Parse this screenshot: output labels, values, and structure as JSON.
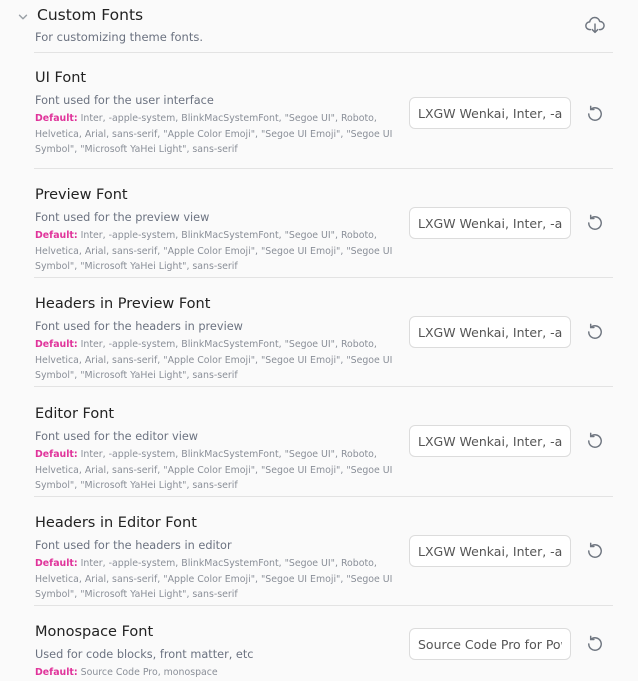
{
  "section": {
    "title": "Custom Fonts",
    "description": "For customizing theme fonts.",
    "collapse_icon": "chevron-down-icon",
    "export_icon": "cloud-download-icon"
  },
  "colors": {
    "default_label": "#e0339a",
    "description_text": "#6b7280"
  },
  "settings": [
    {
      "name": "UI Font",
      "description": "Font used for the user interface",
      "default_label": "Default:",
      "default_value": "Inter, -apple-system, BlinkMacSystemFont, \"Segoe UI\", Roboto, Helvetica, Arial, sans-serif, \"Apple Color Emoji\", \"Segoe UI Emoji\", \"Segoe UI Symbol\", \"Microsoft YaHei Light\", sans-serif",
      "input_value": "LXGW Wenkai, Inter, -apple-system",
      "reset_icon": "reset-icon"
    },
    {
      "name": "Preview Font",
      "description": "Font used for the preview view",
      "default_label": "Default:",
      "default_value": "Inter, -apple-system, BlinkMacSystemFont, \"Segoe UI\", Roboto, Helvetica, Arial, sans-serif, \"Apple Color Emoji\", \"Segoe UI Emoji\", \"Segoe UI Symbol\", \"Microsoft YaHei Light\", sans-serif",
      "input_value": "LXGW Wenkai, Inter, -apple-system",
      "reset_icon": "reset-icon"
    },
    {
      "name": "Headers in Preview Font",
      "description": "Font used for the headers in preview",
      "default_label": "Default:",
      "default_value": "Inter, -apple-system, BlinkMacSystemFont, \"Segoe UI\", Roboto, Helvetica, Arial, sans-serif, \"Apple Color Emoji\", \"Segoe UI Emoji\", \"Segoe UI Symbol\", \"Microsoft YaHei Light\", sans-serif",
      "input_value": "LXGW Wenkai, Inter, -apple-system",
      "reset_icon": "reset-icon"
    },
    {
      "name": "Editor Font",
      "description": "Font used for the editor view",
      "default_label": "Default:",
      "default_value": "Inter, -apple-system, BlinkMacSystemFont, \"Segoe UI\", Roboto, Helvetica, Arial, sans-serif, \"Apple Color Emoji\", \"Segoe UI Emoji\", \"Segoe UI Symbol\", \"Microsoft YaHei Light\", sans-serif",
      "input_value": "LXGW Wenkai, Inter, -apple-system",
      "reset_icon": "reset-icon"
    },
    {
      "name": "Headers in Editor Font",
      "description": "Font used for the headers in editor",
      "default_label": "Default:",
      "default_value": "Inter, -apple-system, BlinkMacSystemFont, \"Segoe UI\", Roboto, Helvetica, Arial, sans-serif, \"Apple Color Emoji\", \"Segoe UI Emoji\", \"Segoe UI Symbol\", \"Microsoft YaHei Light\", sans-serif",
      "input_value": "LXGW Wenkai, Inter, -apple-system",
      "reset_icon": "reset-icon"
    },
    {
      "name": "Monospace Font",
      "description": "Used for code blocks, front matter, etc",
      "default_label": "Default:",
      "default_value": "Source Code Pro, monospace",
      "input_value": "Source Code Pro for Powerline",
      "reset_icon": "reset-icon"
    }
  ]
}
